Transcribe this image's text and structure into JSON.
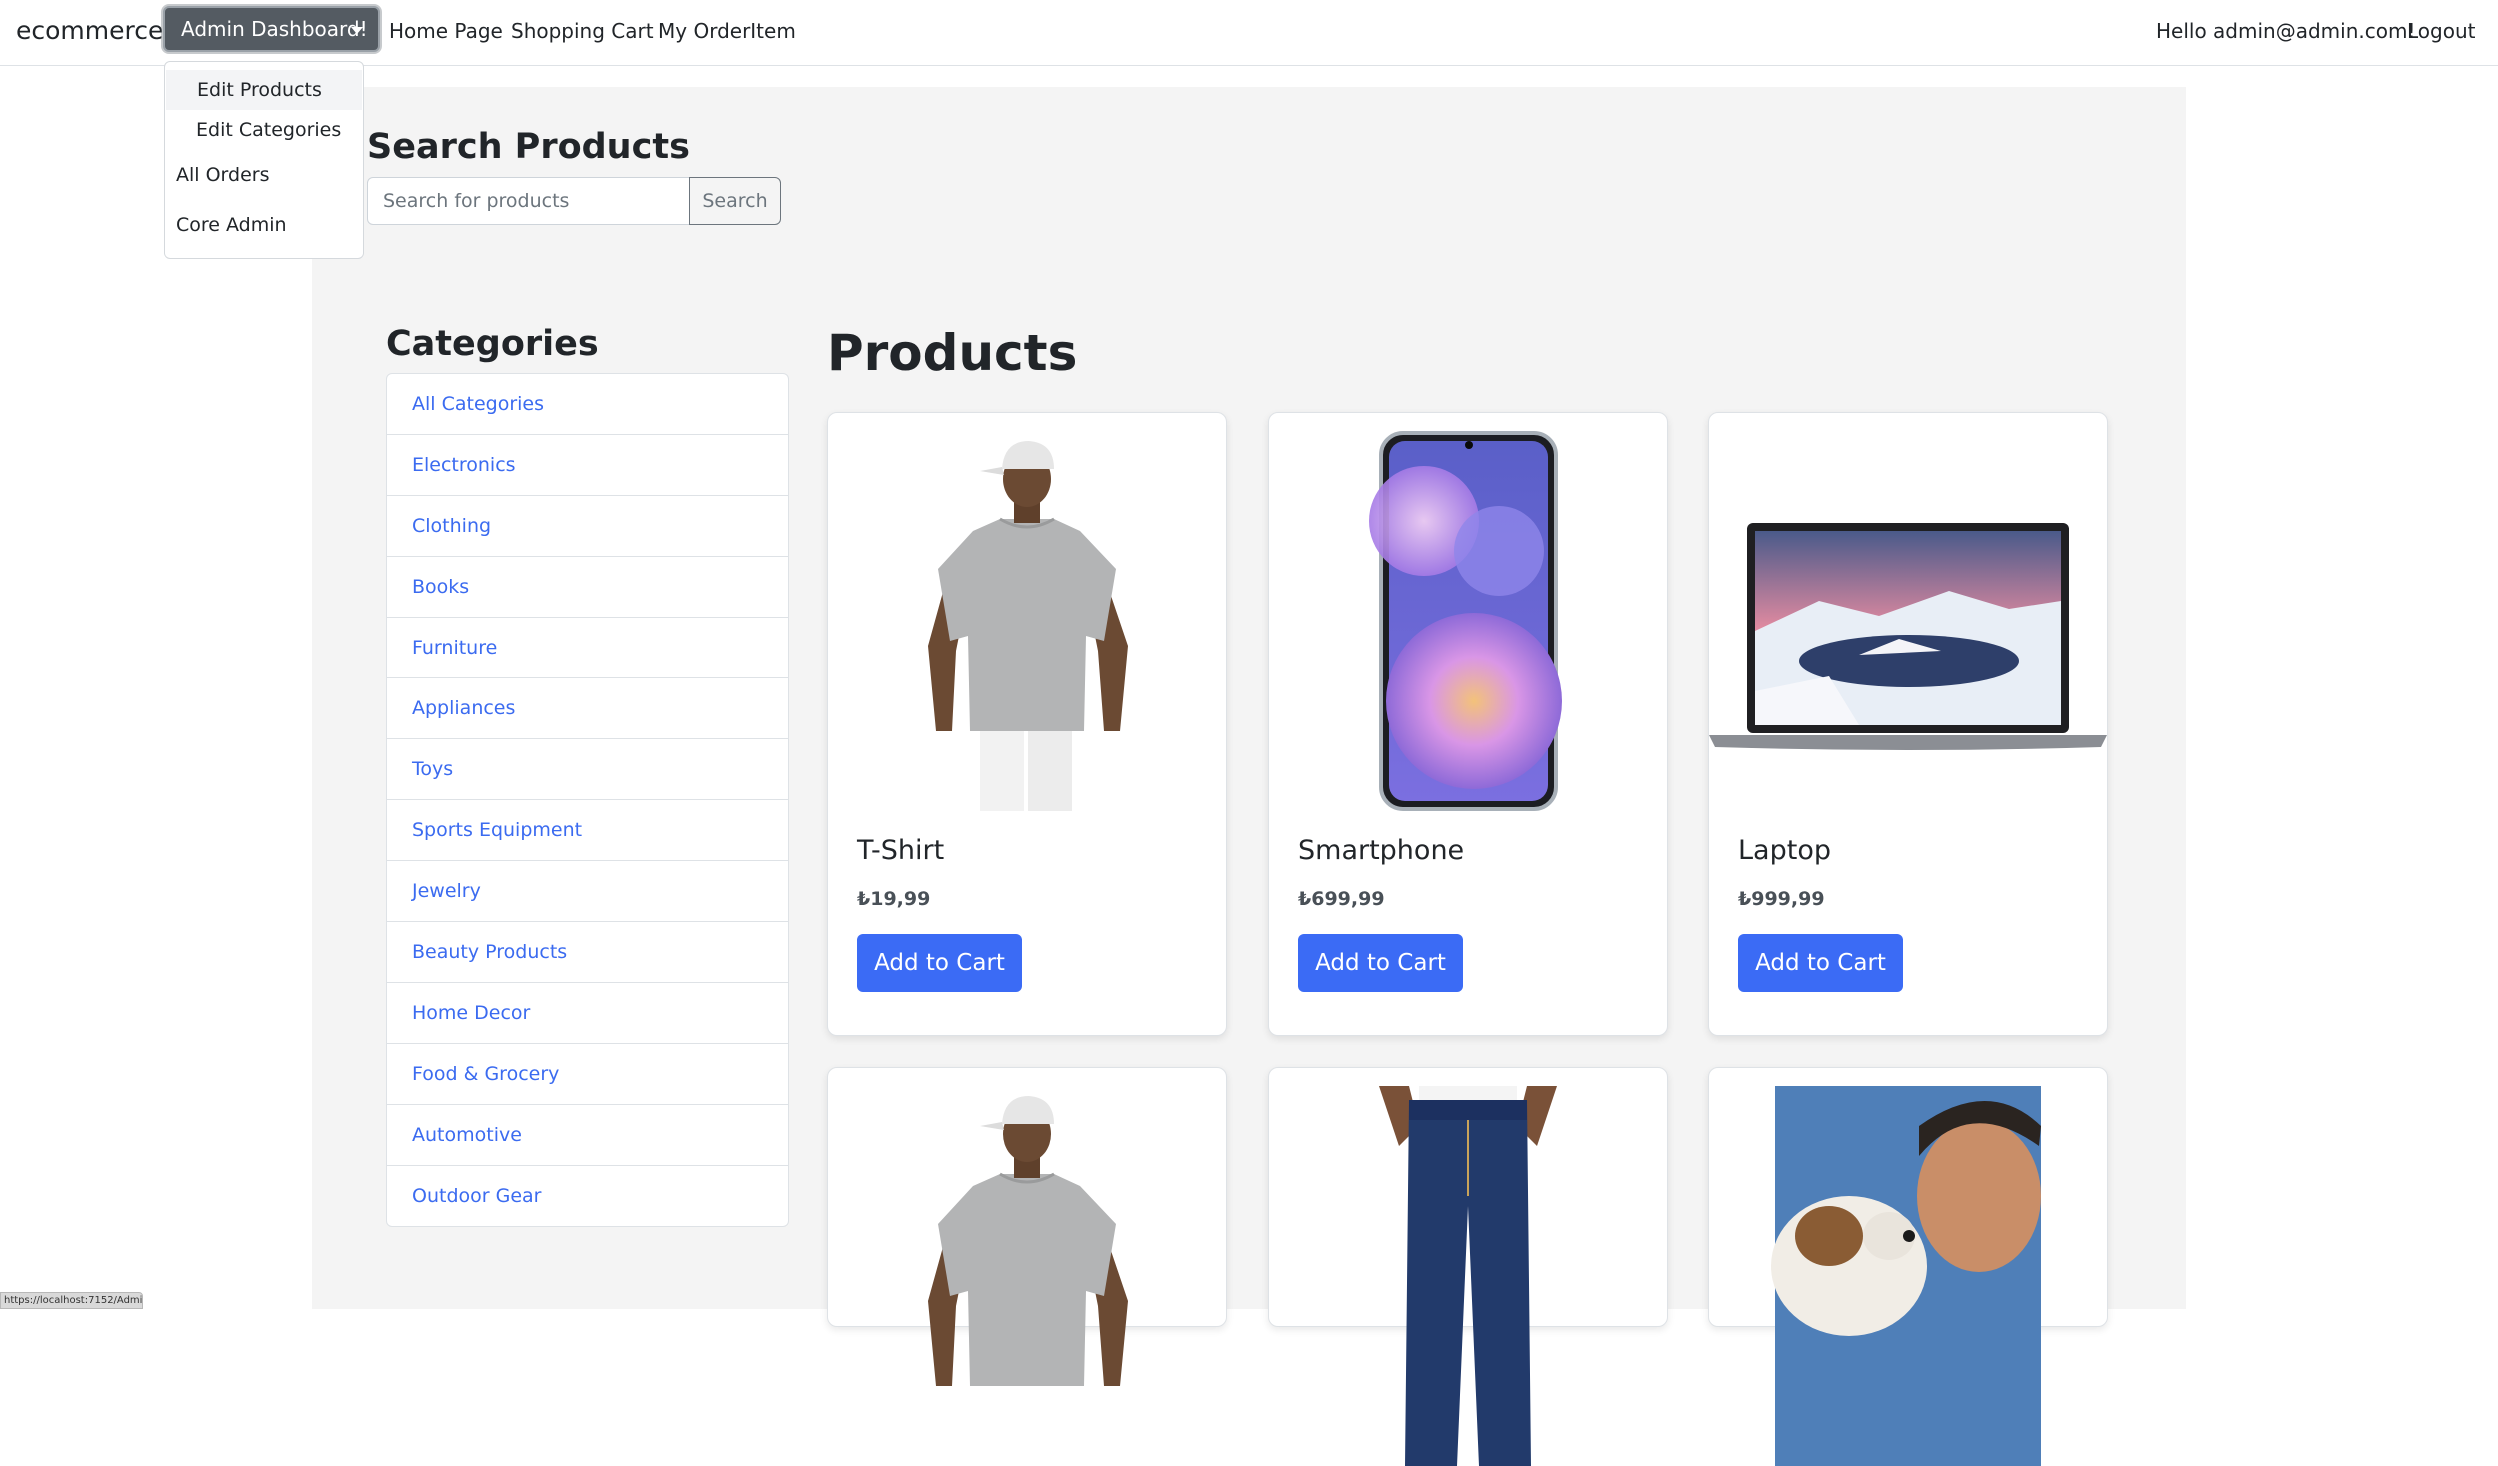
{
  "navbar": {
    "brand": "ecommerce",
    "admin_dropdown_label": "Admin Dashboard!",
    "links": [
      "Home Page",
      "Shopping Cart",
      "My OrderItem"
    ],
    "greeting": "Hello admin@admin.com!",
    "logout": "Logout"
  },
  "dropdown": {
    "items": [
      "Edit Products",
      "Edit Categories",
      "All Orders",
      "Core Admin"
    ]
  },
  "search": {
    "title": "Search Products",
    "placeholder": "Search for products",
    "button_label": "Search"
  },
  "categories": {
    "title": "Categories",
    "items": [
      "All Categories",
      "Electronics",
      "Clothing",
      "Books",
      "Furniture",
      "Appliances",
      "Toys",
      "Sports Equipment",
      "Jewelry",
      "Beauty Products",
      "Home Decor",
      "Food & Grocery",
      "Automotive",
      "Outdoor Gear"
    ]
  },
  "products": {
    "title": "Products",
    "add_to_cart_label": "Add to Cart",
    "items": [
      {
        "name": "T-Shirt",
        "price": "₺19,99",
        "image": "man-grey-tshirt-white-cap"
      },
      {
        "name": "Smartphone",
        "price": "₺699,99",
        "image": "smartphone-purple-wallpaper"
      },
      {
        "name": "Laptop",
        "price": "₺999,99",
        "image": "laptop-snowy-lake"
      },
      {
        "image": "man-grey-tshirt-white-cap"
      },
      {
        "image": "blue-jeans"
      },
      {
        "image": "man-with-dog"
      }
    ]
  },
  "status_bar": {
    "url": "https://localhost:7152/Admin"
  },
  "colors": {
    "link": "#3b6bf0",
    "primary_button": "#3b6bf5",
    "admin_button": "#545b62",
    "main_background": "#f4f4f4"
  }
}
